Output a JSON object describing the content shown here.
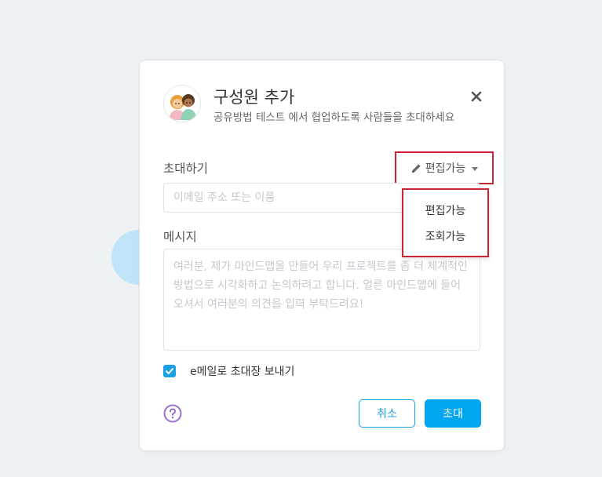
{
  "dialog": {
    "title": "구성원 추가",
    "subtitle": "공유방법 테스트 에서 협업하도록 사람들을 초대하세요",
    "close_icon": "close-icon",
    "avatar_icon": "people-avatar-icon"
  },
  "invite": {
    "label": "초대하기",
    "permission": {
      "selected": "편집가능",
      "icon": "pencil-icon",
      "options": [
        "편집가능",
        "조회가능"
      ]
    },
    "email_placeholder": "이메일 주소 또는 이름"
  },
  "message": {
    "label": "메시지",
    "placeholder": "여러분, 제가 마인드맵을 만들어 우리 프로젝트를 좀 더 체계적인 방법으로 시각화하고 논의하려고 합니다. 얼른 마인드맵에 들어오셔서 여러분의 의견을 입력 부탁드려요!"
  },
  "email_option": {
    "label": "e메일로 초대장 보내기",
    "checked": true
  },
  "footer": {
    "help_icon": "help-icon",
    "cancel_label": "취소",
    "invite_label": "초대"
  },
  "colors": {
    "accent": "#00a6f0",
    "highlight_border": "#cc2233",
    "help_icon": "#9b6fcf"
  }
}
